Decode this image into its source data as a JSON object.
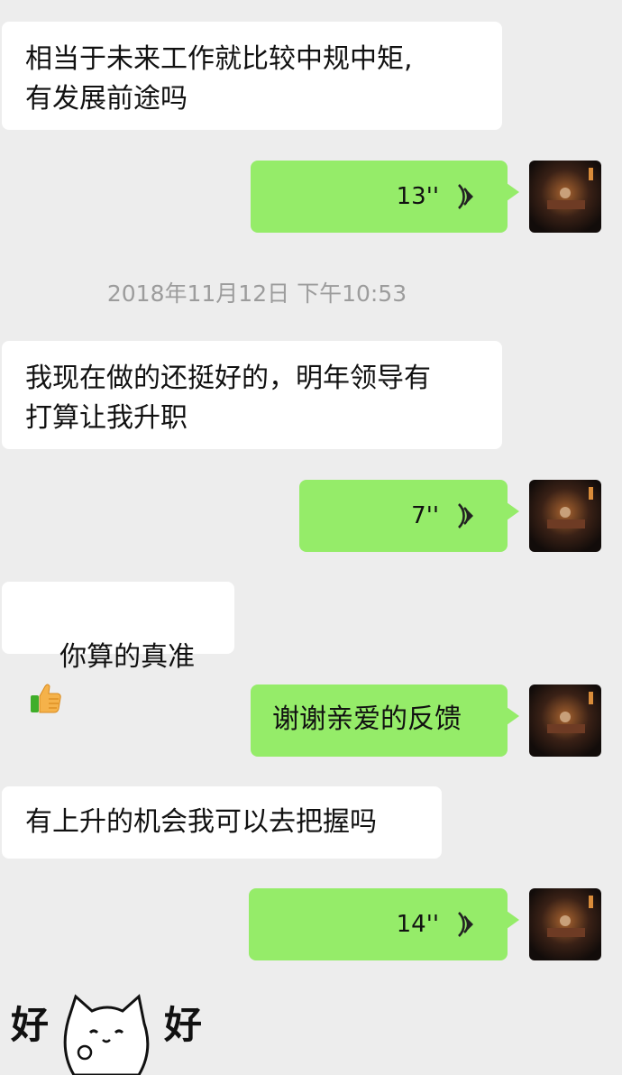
{
  "messages": {
    "m1": {
      "text": "相当于未来工作就比较中规中矩,\n有发展前途吗"
    },
    "m2": {
      "duration": "13''"
    },
    "timestamp": "2018年11月12日 下午10:53",
    "m3": {
      "text": "我现在做的还挺好的，明年领导有\n打算让我升职"
    },
    "m4": {
      "duration": "7''"
    },
    "m5": {
      "text": "你算的真准"
    },
    "m6": {
      "text": "谢谢亲爱的反馈"
    },
    "m7": {
      "text": "有上升的机会我可以去把握吗"
    },
    "m8": {
      "duration": "14''"
    }
  },
  "sticker": {
    "left_char": "好",
    "right_char": "好"
  },
  "icons": {
    "voice": "voice-wave-icon",
    "thumb": "thumbs-up-emoji",
    "avatar": "avatar"
  },
  "colors": {
    "background": "#ededed",
    "incoming_bubble": "#ffffff",
    "outgoing_bubble": "#95ec69",
    "timestamp_text": "#9c9c9c"
  }
}
